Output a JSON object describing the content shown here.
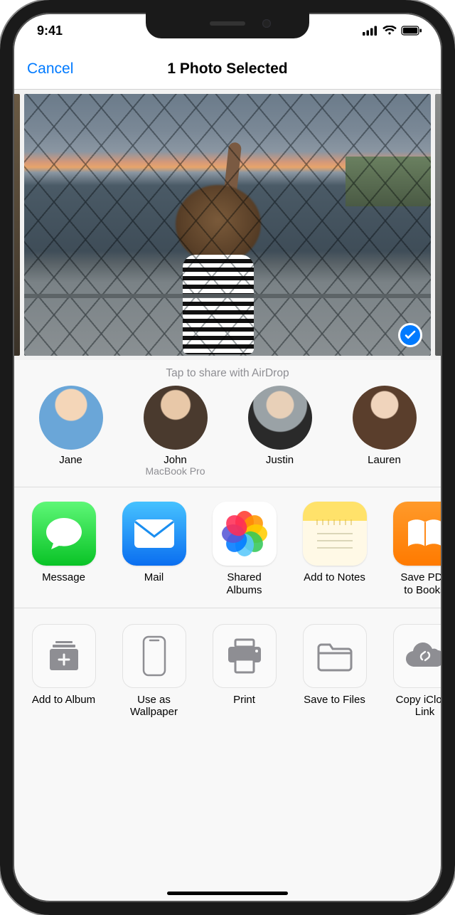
{
  "status": {
    "time": "9:41"
  },
  "nav": {
    "cancel": "Cancel",
    "title": "1 Photo Selected"
  },
  "airdrop": {
    "prompt": "Tap to share with AirDrop",
    "contacts": [
      {
        "name": "Jane",
        "device": ""
      },
      {
        "name": "John",
        "device": "MacBook Pro"
      },
      {
        "name": "Justin",
        "device": ""
      },
      {
        "name": "Lauren",
        "device": ""
      }
    ]
  },
  "apps": [
    {
      "label": "Message"
    },
    {
      "label": "Mail"
    },
    {
      "label": "Shared\nAlbums"
    },
    {
      "label": "Add to Notes"
    },
    {
      "label": "Save PDF\nto Books"
    }
  ],
  "actions": [
    {
      "label": "Add to Album"
    },
    {
      "label": "Use as\nWallpaper"
    },
    {
      "label": "Print"
    },
    {
      "label": "Save to Files"
    },
    {
      "label": "Copy iCloud\nLink"
    }
  ]
}
